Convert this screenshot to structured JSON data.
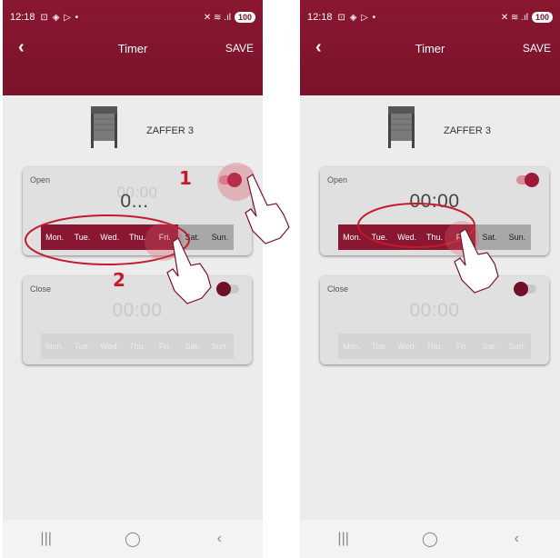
{
  "status": {
    "time": "12:18",
    "battery": "100",
    "left_icons": "⊡ ◈ ▷ •",
    "right_icons": "✕ ≋ .ıl"
  },
  "header": {
    "title": "Timer",
    "save_label": "SAVE",
    "back_icon": "chevron-left-icon"
  },
  "device": {
    "name": "ZAFFER 3"
  },
  "screens": [
    {
      "open": {
        "label": "Open",
        "time_ghost": "00:00",
        "time": "0...",
        "enabled": true
      },
      "close": {
        "label": "Close",
        "time": "00:00",
        "enabled": false
      }
    },
    {
      "open": {
        "label": "Open",
        "time": "00:00",
        "enabled": true
      },
      "close": {
        "label": "Close",
        "time": "00:00",
        "enabled": false
      }
    }
  ],
  "days": [
    "Mon.",
    "Tue.",
    "Wed.",
    "Thu.",
    "Fri.",
    "Sat.",
    "Sun."
  ],
  "open_days_selected": [
    true,
    true,
    true,
    true,
    true,
    false,
    false
  ],
  "annotations": {
    "step1": "1",
    "step2": "2"
  },
  "colors": {
    "brand": "#8a1731",
    "annotation": "#c41a2c"
  }
}
